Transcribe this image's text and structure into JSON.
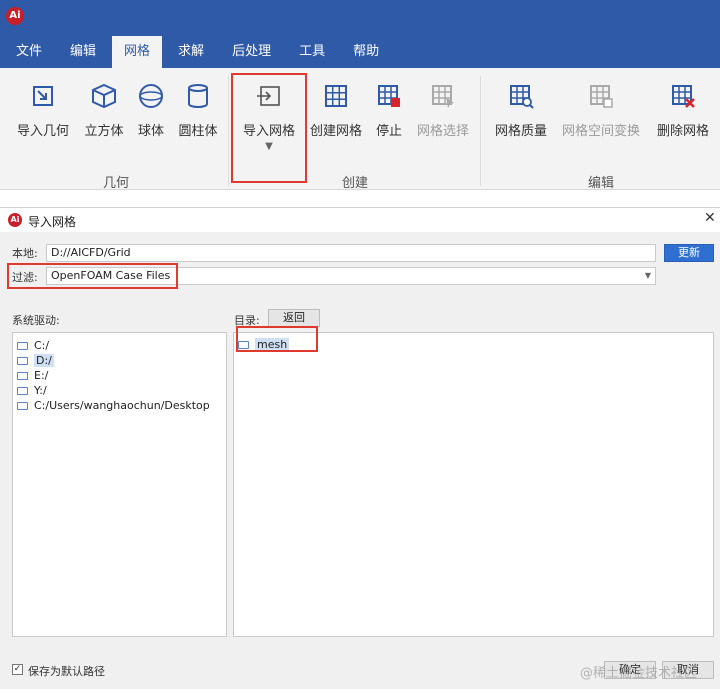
{
  "app": {
    "logo_text": "Ai",
    "menu": [
      "文件",
      "编辑",
      "网格",
      "求解",
      "后处理",
      "工具",
      "帮助"
    ],
    "active_menu": "网格",
    "ribbon": {
      "geometry_buttons": [
        "导入几何",
        "立方体",
        "球体",
        "圆柱体"
      ],
      "geometry_group": "几何",
      "create_buttons": [
        "导入网格",
        "创建网格",
        "停止",
        "网格选择"
      ],
      "create_group": "创建",
      "edit_buttons": [
        "网格质量",
        "网格空间变换",
        "删除网格"
      ],
      "edit_group": "编辑",
      "dropdown_caret": "▼"
    }
  },
  "dialog": {
    "title": "导入网格",
    "close": "✕",
    "local_label": "本地:",
    "local_path": "D://AICFD/Grid",
    "refresh": "更新",
    "filter_label": "过滤:",
    "filter_value": "OpenFOAM Case Files",
    "drives_label": "系统驱动:",
    "drives": [
      "C:/",
      "D:/",
      "E:/",
      "Y:/",
      "C:/Users/wanghaochun/Desktop"
    ],
    "selected_drive": "D:/",
    "dir_label": "目录:",
    "back": "返回",
    "dir_items": [
      "mesh"
    ],
    "save_default": "保存为默认路径",
    "save_default_checked": "✓",
    "ok": "确定",
    "cancel": "取消"
  },
  "watermark": "@稀土掘金技术社区",
  "colors": {
    "menubar": "#2f5aa8",
    "highlight": "#e03a2f",
    "primary_button": "#2f6fd1",
    "icon_blue": "#2f5aa8",
    "icon_red": "#d9232d"
  }
}
